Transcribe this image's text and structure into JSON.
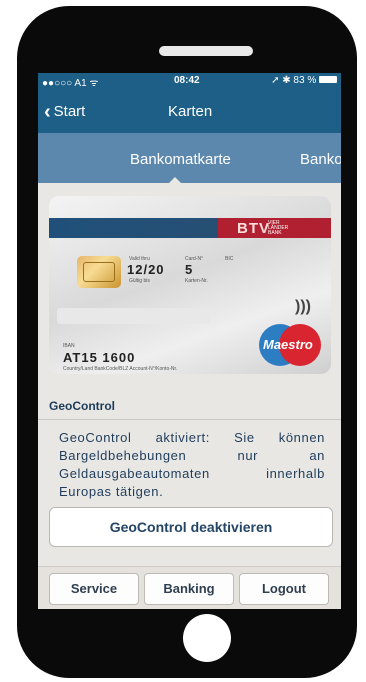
{
  "status_bar": {
    "carrier": "●●○○○ A1 ᯤ",
    "time": "08:42",
    "right": "➚ ✱ 83 %"
  },
  "nav": {
    "back_label": "Start",
    "title": "Karten"
  },
  "tabs": [
    "Bankomatkarte",
    "Banko"
  ],
  "card": {
    "brand": "BTV",
    "brand_small": "VIER LÄNDER BANK",
    "valid_label": "Valid thru",
    "valid_sub": "Gültig bis",
    "expiry": "12/20",
    "cardno_label": "Card-N°",
    "cardno_sub": "Karten-Nr.",
    "card_number": "5",
    "bic_label": "BIC",
    "iban_small": "IBAN",
    "iban": "AT15 1600",
    "footer": "Country/Land   BankCode/BLZ   Account-N°/Konto-Nr.",
    "network": "Maestro"
  },
  "geocontrol": {
    "title": "GeoControl",
    "text": "GeoControl aktiviert: Sie können Bargeldbehebungen nur an Geldausgabeautomaten innerhalb Europas tätigen.",
    "button": "GeoControl deaktivieren"
  },
  "bottom_bar": [
    "Service",
    "Banking",
    "Logout"
  ],
  "colors": {
    "header": "#1d5f86",
    "tabs": "#5d88ad",
    "card_red": "#b02030"
  }
}
